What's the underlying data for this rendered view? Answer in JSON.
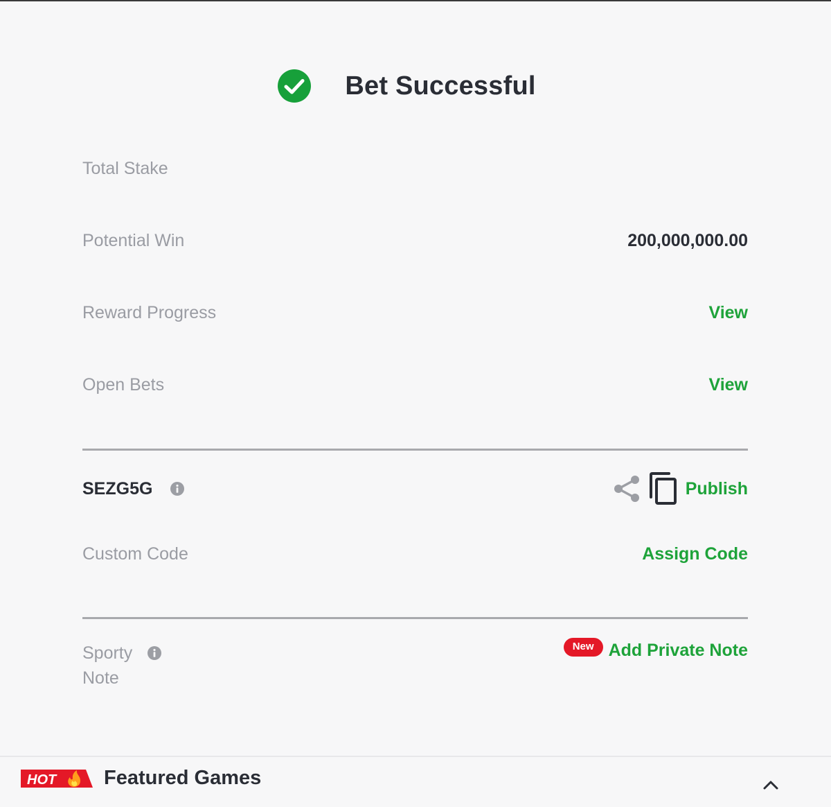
{
  "header": {
    "title": "Bet Successful",
    "icon": "check-circle-icon"
  },
  "summary": {
    "total_stake_label": "Total Stake",
    "total_stake_value": "",
    "potential_win_label": "Potential Win",
    "potential_win_value": "200,000,000.00",
    "reward_progress_label": "Reward Progress",
    "reward_progress_action": "View",
    "open_bets_label": "Open Bets",
    "open_bets_action": "View"
  },
  "booking": {
    "code": "SEZG5G",
    "publish_label": "Publish",
    "custom_code_label": "Custom Code",
    "assign_code_label": "Assign Code"
  },
  "note": {
    "label": "Sporty Note",
    "badge": "New",
    "action_label": "Add Private Note"
  },
  "footer": {
    "hot_badge": "HOT",
    "title": "Featured Games"
  },
  "colors": {
    "accent_green": "#1ea33a",
    "badge_red": "#e41827",
    "text_dark": "#2a2d35",
    "text_muted": "#9a9ca3"
  }
}
